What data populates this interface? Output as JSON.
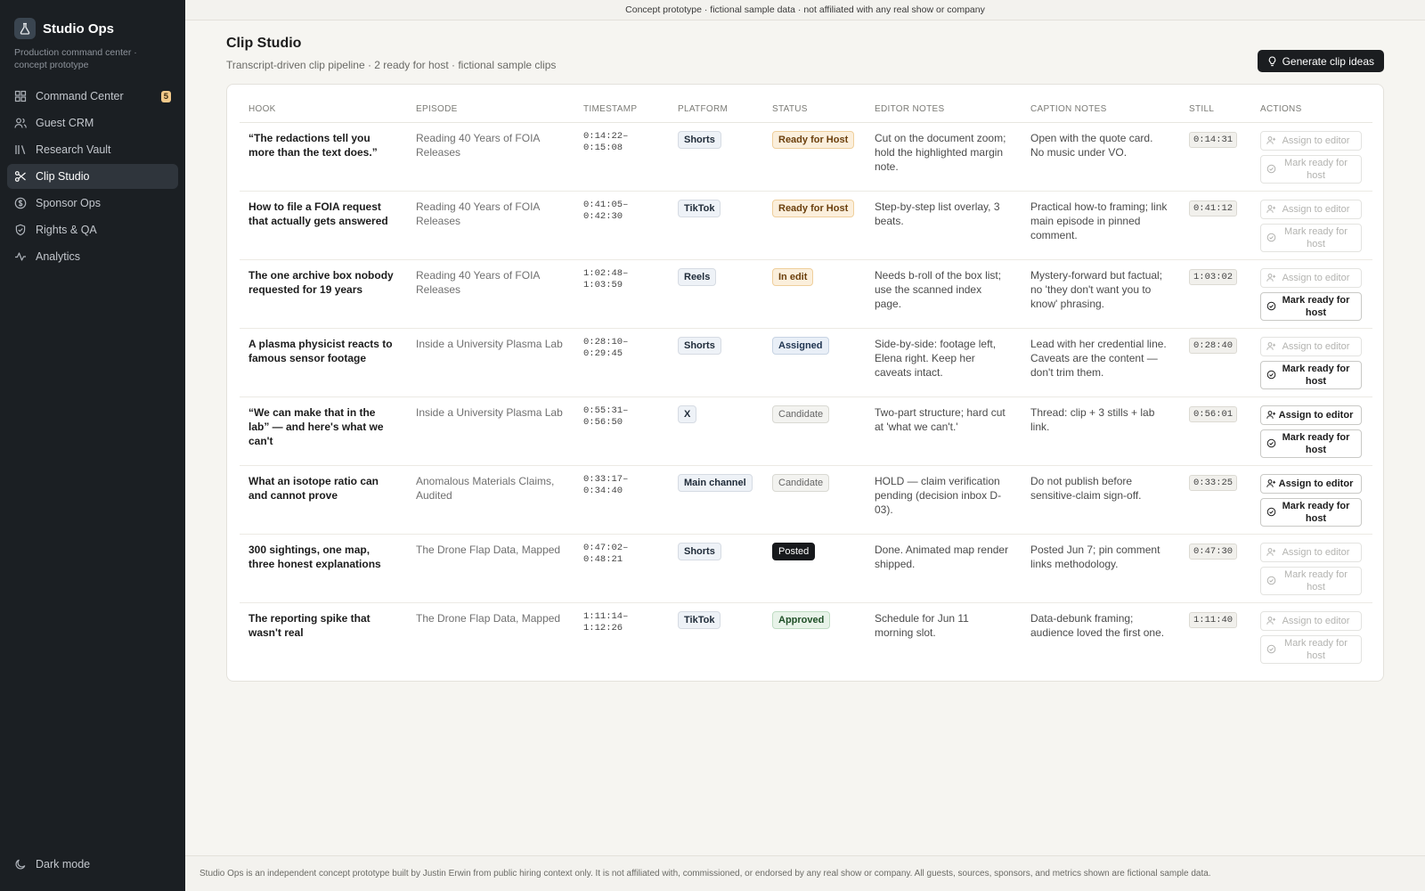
{
  "sidebar": {
    "brand_name": "Studio Ops",
    "brand_sub": "Production command center · concept prototype",
    "items": [
      {
        "label": "Command Center",
        "badge": "5"
      },
      {
        "label": "Guest CRM"
      },
      {
        "label": "Research Vault"
      },
      {
        "label": "Clip Studio"
      },
      {
        "label": "Sponsor Ops"
      },
      {
        "label": "Rights & QA"
      },
      {
        "label": "Analytics"
      }
    ],
    "dark_mode_label": "Dark mode"
  },
  "banner": "Concept prototype · fictional sample data · not affiliated with any real show or company",
  "page": {
    "title": "Clip Studio",
    "subtitle": "Transcript-driven clip pipeline · 2 ready for host · fictional sample clips",
    "generate_label": "Generate clip ideas"
  },
  "table": {
    "headers": [
      "HOOK",
      "EPISODE",
      "TIMESTAMP",
      "PLATFORM",
      "STATUS",
      "EDITOR NOTES",
      "CAPTION NOTES",
      "STILL",
      "ACTIONS"
    ],
    "assign_label": "Assign to editor",
    "ready_label": "Mark ready for host",
    "rows": [
      {
        "hook": "“The redactions tell you more than the text does.”",
        "episode": "Reading 40 Years of FOIA Releases",
        "timestamp": "0:14:22–\n0:15:08",
        "platform": "Shorts",
        "status": "Ready for Host",
        "editor_notes": "Cut on the document zoom; hold the highlighted margin note.",
        "caption_notes": "Open with the quote card. No music under VO.",
        "still": "0:14:31"
      },
      {
        "hook": "How to file a FOIA request that actually gets answered",
        "episode": "Reading 40 Years of FOIA Releases",
        "timestamp": "0:41:05–\n0:42:30",
        "platform": "TikTok",
        "status": "Ready for Host",
        "editor_notes": "Step-by-step list overlay, 3 beats.",
        "caption_notes": "Practical how-to framing; link main episode in pinned comment.",
        "still": "0:41:12"
      },
      {
        "hook": "The one archive box nobody requested for 19 years",
        "episode": "Reading 40 Years of FOIA Releases",
        "timestamp": "1:02:48–\n1:03:59",
        "platform": "Reels",
        "status": "In edit",
        "editor_notes": "Needs b-roll of the box list; use the scanned index page.",
        "caption_notes": "Mystery-forward but factual; no 'they don't want you to know' phrasing.",
        "still": "1:03:02"
      },
      {
        "hook": "A plasma physicist reacts to famous sensor footage",
        "episode": "Inside a University Plasma Lab",
        "timestamp": "0:28:10–\n0:29:45",
        "platform": "Shorts",
        "status": "Assigned",
        "editor_notes": "Side-by-side: footage left, Elena right. Keep her caveats intact.",
        "caption_notes": "Lead with her credential line. Caveats are the content — don't trim them.",
        "still": "0:28:40"
      },
      {
        "hook": "“We can make that in the lab” — and here's what we can't",
        "episode": "Inside a University Plasma Lab",
        "timestamp": "0:55:31–\n0:56:50",
        "platform": "X",
        "status": "Candidate",
        "editor_notes": "Two-part structure; hard cut at 'what we can't.'",
        "caption_notes": "Thread: clip + 3 stills + lab link.",
        "still": "0:56:01"
      },
      {
        "hook": "What an isotope ratio can and cannot prove",
        "episode": "Anomalous Materials Claims, Audited",
        "timestamp": "0:33:17–\n0:34:40",
        "platform": "Main channel",
        "status": "Candidate",
        "editor_notes": "HOLD — claim verification pending (decision inbox D-03).",
        "caption_notes": "Do not publish before sensitive-claim sign-off.",
        "still": "0:33:25"
      },
      {
        "hook": "300 sightings, one map, three honest explanations",
        "episode": "The Drone Flap Data, Mapped",
        "timestamp": "0:47:02–\n0:48:21",
        "platform": "Shorts",
        "status": "Posted",
        "editor_notes": "Done. Animated map render shipped.",
        "caption_notes": "Posted Jun 7; pin comment links methodology.",
        "still": "0:47:30"
      },
      {
        "hook": "The reporting spike that wasn't real",
        "episode": "The Drone Flap Data, Mapped",
        "timestamp": "1:11:14–\n1:12:26",
        "platform": "TikTok",
        "status": "Approved",
        "editor_notes": "Schedule for Jun 11 morning slot.",
        "caption_notes": "Data-debunk framing; audience loved the first one.",
        "still": "1:11:40"
      }
    ]
  },
  "footer": "Studio Ops is an independent concept prototype built by Justin Erwin from public hiring context only. It is not affiliated with, commissioned, or endorsed by any real show or company. All guests, sources, sponsors, and metrics shown are fictional sample data."
}
